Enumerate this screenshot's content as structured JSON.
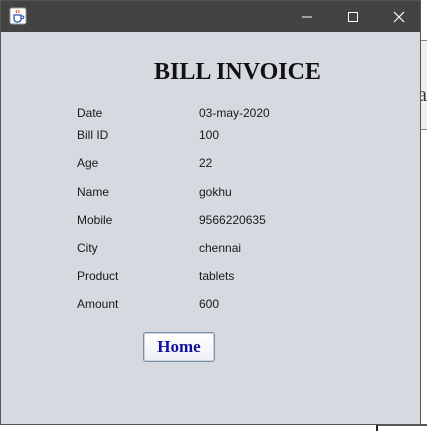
{
  "window": {
    "icon": "java-cup-icon",
    "controls": [
      "minimize-icon",
      "maximize-icon",
      "close-icon"
    ]
  },
  "heading": "BILL INVOICE",
  "fields": [
    {
      "label": "Date",
      "value": "03-may-2020"
    },
    {
      "label": "Bill ID",
      "value": "100"
    },
    {
      "label": "Age",
      "value": "22"
    },
    {
      "label": "Name",
      "value": "gokhu"
    },
    {
      "label": "Mobile",
      "value": "9566220635"
    },
    {
      "label": "City",
      "value": "chennai"
    },
    {
      "label": "Product",
      "value": "tablets"
    },
    {
      "label": "Amount",
      "value": "600"
    }
  ],
  "home_button": "Home",
  "background_glyph": "a",
  "colors": {
    "titlebar": "#434343",
    "window_bg": "#d6d9e0",
    "button_text": "#1010a0"
  }
}
